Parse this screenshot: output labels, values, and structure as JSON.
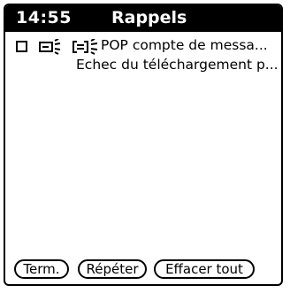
{
  "status": {
    "time": "14:55",
    "title": "Rappels"
  },
  "reminders": [
    {
      "line1": "POP compte de messa...",
      "line2": "Echec du téléchargement p..."
    }
  ],
  "buttons": {
    "term": "Term.",
    "repeat": "Répéter",
    "clear_all": "Effacer tout"
  }
}
